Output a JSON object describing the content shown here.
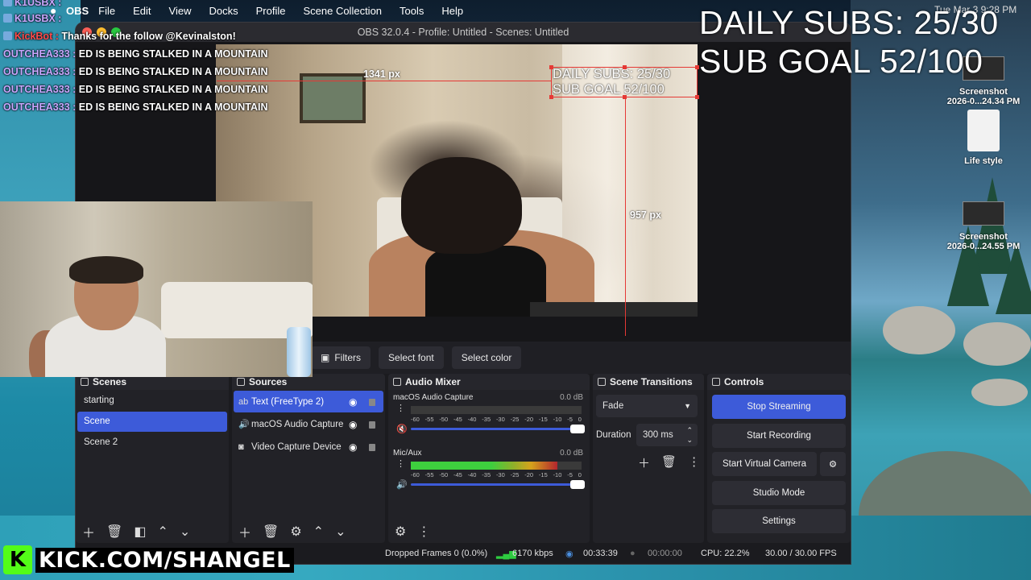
{
  "menubar": {
    "app": "OBS",
    "items": [
      "File",
      "Edit",
      "View",
      "Docks",
      "Profile",
      "Scene Collection",
      "Tools",
      "Help"
    ],
    "clock": "Tue Mar 3  9:28 PM"
  },
  "chat": {
    "top_users": [
      "K1USBX :",
      "K1USBX :"
    ],
    "kickbot_user": "KickBot :",
    "kickbot_msg": "Thanks for the follow @Kevinalston!",
    "lines": [
      {
        "user": "OUTCHEA333 :",
        "msg": "ED IS BEING STALKED IN A MOUNTAIN"
      },
      {
        "user": "OUTCHEA333 :",
        "msg": "ED IS BEING STALKED IN A MOUNTAIN"
      },
      {
        "user": "OUTCHEA333 :",
        "msg": "ED IS BEING STALKED IN A MOUNTAIN"
      },
      {
        "user": "OUTCHEA333 :",
        "msg": "ED IS BEING STALKED IN A MOUNTAIN"
      }
    ]
  },
  "overlay": {
    "daily_subs": "DAILY SUBS: 25/30",
    "sub_goal": "SUB GOAL 52/100"
  },
  "desktop": {
    "items": [
      {
        "label_1": "Screenshot",
        "label_2": "2026-0...24.34 PM"
      },
      {
        "label_1": "Life style",
        "label_2": ""
      },
      {
        "label_1": "Screenshot",
        "label_2": "2026-0...24.55 PM"
      }
    ]
  },
  "window": {
    "title": "OBS 32.0.4 - Profile: Untitled - Scenes: Untitled"
  },
  "preview": {
    "selected_text_line1": "DAILY SUBS: 25/30",
    "selected_text_line2": "SUB GOAL 52/100",
    "guide_horizontal": "1341 px",
    "guide_vertical": "957 px"
  },
  "context_bar": {
    "filters": "Filters",
    "select_font": "Select font",
    "select_color": "Select color"
  },
  "scenes": {
    "title": "Scenes",
    "items": [
      "starting",
      "Scene",
      "Scene 2"
    ],
    "active_index": 1
  },
  "sources": {
    "title": "Sources",
    "items": [
      {
        "label": "Text (FreeType 2)",
        "icon": "text-icon"
      },
      {
        "label": "macOS Audio Capture",
        "icon": "speaker-icon"
      },
      {
        "label": "Video Capture Device",
        "icon": "camera-icon"
      }
    ]
  },
  "mixer": {
    "title": "Audio Mixer",
    "channels": [
      {
        "name": "macOS Audio Capture",
        "db": "0.0 dB",
        "muted": true,
        "level": 0.0
      },
      {
        "name": "Mic/Aux",
        "db": "0.0 dB",
        "muted": false,
        "level": 0.86
      }
    ],
    "scale": [
      "-60",
      "-55",
      "-50",
      "-45",
      "-40",
      "-35",
      "-30",
      "-25",
      "-20",
      "-15",
      "-10",
      "-5",
      "0"
    ]
  },
  "transitions": {
    "title": "Scene Transitions",
    "selected": "Fade",
    "duration_label": "Duration",
    "duration_value": "300 ms"
  },
  "controls": {
    "title": "Controls",
    "stop_streaming": "Stop Streaming",
    "start_recording": "Start Recording",
    "start_virtual_camera": "Start Virtual Camera",
    "studio_mode": "Studio Mode",
    "settings": "Settings"
  },
  "status": {
    "dropped_frames": "Dropped Frames 0 (0.0%)",
    "bitrate": "6170 kbps",
    "stream_time": "00:33:39",
    "record_time": "00:00:00",
    "cpu": "CPU: 22.2%",
    "fps": "30.00 / 30.00 FPS"
  },
  "brand": {
    "logo": "K",
    "text": "KICK.COM/SHANGEL"
  }
}
